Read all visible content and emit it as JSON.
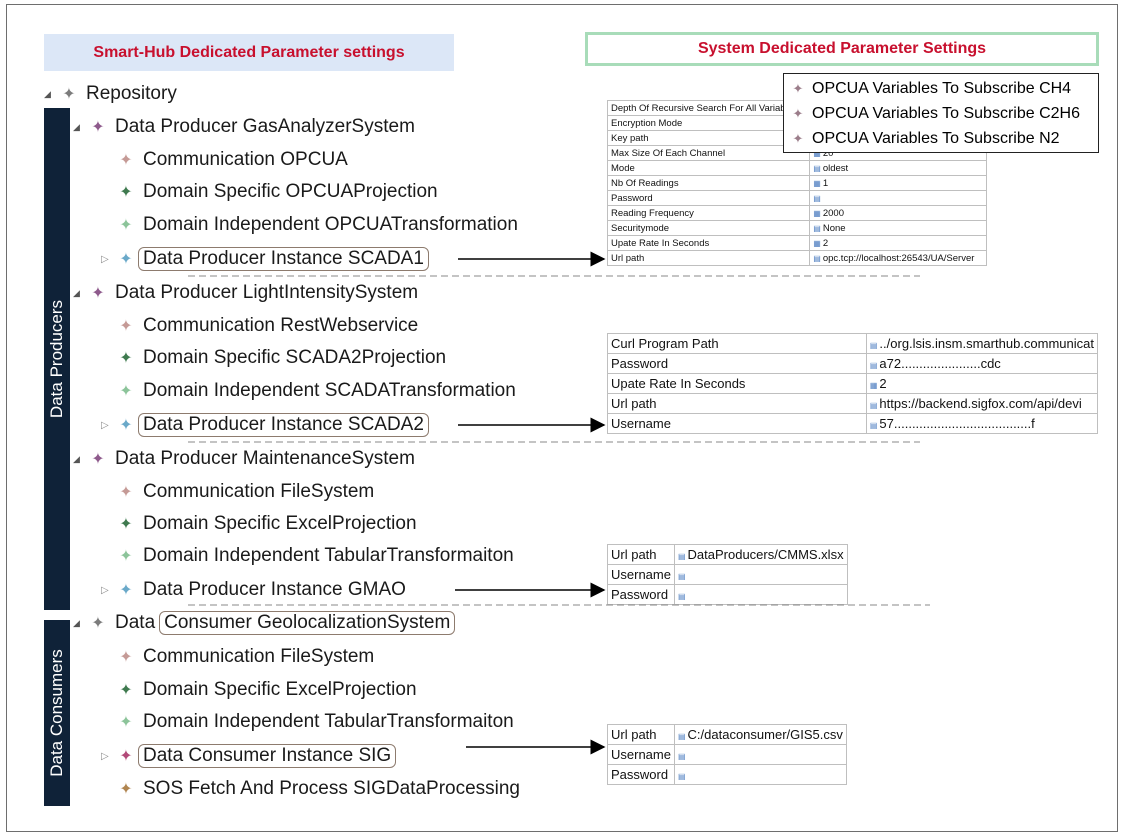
{
  "headers": {
    "left": "Smart-Hub Dedicated Parameter settings",
    "right": "System Dedicated Parameter Settings"
  },
  "bands": {
    "producers": "Data Producers",
    "consumers": "Data Consumers"
  },
  "tree": {
    "repository": "Repository",
    "gas_system": "Data Producer GasAnalyzerSystem",
    "gas_comm": "Communication OPCUA",
    "gas_domain_specific": "Domain Specific OPCUAProjection",
    "gas_domain_independent": "Domain Independent OPCUATransformation",
    "gas_instance": "Data Producer Instance SCADA1",
    "light_system": "Data Producer LightIntensitySystem",
    "light_comm": "Communication RestWebservice",
    "light_domain_specific": "Domain Specific SCADA2Projection",
    "light_domain_independent": "Domain Independent SCADATransformation",
    "light_instance": "Data Producer Instance SCADA2",
    "maint_system": "Data Producer MaintenanceSystem",
    "maint_comm": "Communication FileSystem",
    "maint_domain_specific": "Domain Specific ExcelProjection",
    "maint_domain_independent": "Domain Independent TabularTransformaiton",
    "maint_instance": "Data Producer Instance GMAO",
    "geo_prefix": "Data",
    "geo_system": "Consumer GeolocalizationSystem",
    "geo_comm": "Communication FileSystem",
    "geo_domain_specific": "Domain Specific ExcelProjection",
    "geo_domain_independent": "Domain Independent TabularTransformaiton",
    "geo_instance": "Data Consumer Instance SIG",
    "geo_sos": "SOS Fetch And Process SIGDataProcessing"
  },
  "scada1_props": {
    "labels": [
      "Depth Of Recursive Search For All Variab",
      "Encryption Mode",
      "Key path",
      "Max Size Of Each Channel",
      "Mode",
      "Nb Of Readings",
      "Password",
      "Reading Frequency",
      "Securitymode",
      "Upate Rate In Seconds",
      "Url path"
    ],
    "values": [
      "",
      "",
      "",
      "20",
      "oldest",
      "1",
      "",
      "2000",
      "None",
      "2",
      "opc.tcp://localhost:26543/UA/Server"
    ]
  },
  "subscribe_popup": {
    "items": [
      "OPCUA Variables To Subscribe CH4",
      "OPCUA Variables To Subscribe C2H6",
      "OPCUA Variables To Subscribe N2"
    ]
  },
  "scada2_props": {
    "labels": [
      "Curl Program Path",
      "Password",
      "Upate Rate In Seconds",
      "Url path",
      "Username"
    ],
    "values": [
      "../org.lsis.insm.smarthub.communicat",
      "a72......................cdc",
      "2",
      "https://backend.sigfox.com/api/devi",
      "57......................................f"
    ]
  },
  "gmao_props": {
    "labels": [
      "Url path",
      "Username",
      "Password"
    ],
    "values": [
      "DataProducers/CMMS.xlsx",
      "",
      ""
    ]
  },
  "sig_props": {
    "labels": [
      "Url path",
      "Username",
      "Password"
    ],
    "values": [
      "C:/dataconsumer/GIS5.csv",
      "",
      ""
    ]
  },
  "colors": {
    "header_text": "#c8102e",
    "header_left_bg": "#dce7f7",
    "header_right_border": "#a8dcb9",
    "band_bg": "#0f2238",
    "icon_repository": "#7c7c7c",
    "icon_system": "#8e5a8c",
    "icon_comm": "#c59a96",
    "icon_specific": "#3f7a4f",
    "icon_independent": "#8cc49a",
    "icon_instance": "#6aa9c9",
    "icon_consumer_instance": "#b24a78",
    "icon_sos": "#b08550"
  }
}
